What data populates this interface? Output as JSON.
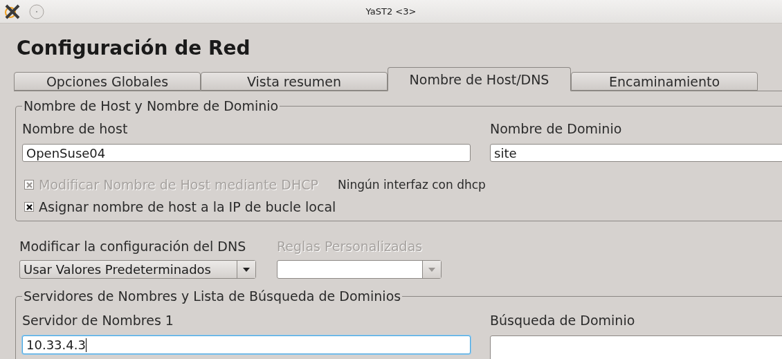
{
  "window": {
    "title": "YaST2 <3>"
  },
  "heading": "Configuración de Red",
  "tabs": [
    {
      "label": "Opciones Globales",
      "selected": false
    },
    {
      "label": "Vista resumen",
      "selected": false
    },
    {
      "label": "Nombre de Host/DNS",
      "selected": true
    },
    {
      "label": "Encaminamiento",
      "selected": false
    }
  ],
  "host_group": {
    "title": "Nombre de Host y Nombre de Dominio",
    "hostname": {
      "label": "Nombre de host",
      "value": "OpenSuse04"
    },
    "domain": {
      "label": "Nombre de Dominio",
      "value": "site"
    },
    "checkboxes": [
      {
        "label": "Modificar Nombre de Host mediante DHCP",
        "checked": true,
        "disabled": true,
        "note": "Ningún interfaz con dhcp"
      },
      {
        "label": "Asignar nombre de host a la IP de bucle local",
        "checked": true,
        "disabled": false
      }
    ]
  },
  "dns_mode": {
    "label": "Modificar la configuración del DNS",
    "value": "Usar Valores Predeterminados",
    "disabled": false
  },
  "custom_rules": {
    "label": "Reglas Personalizadas",
    "disabled": true
  },
  "servers_group": {
    "title": "Servidores de Nombres y Lista de Búsqueda de Dominios",
    "nameserver": {
      "label": "Servidor de Nombres 1",
      "value": "10.33.4.3",
      "focused": true
    },
    "search": {
      "label": "Búsqueda de Dominio",
      "focused": false
    }
  }
}
